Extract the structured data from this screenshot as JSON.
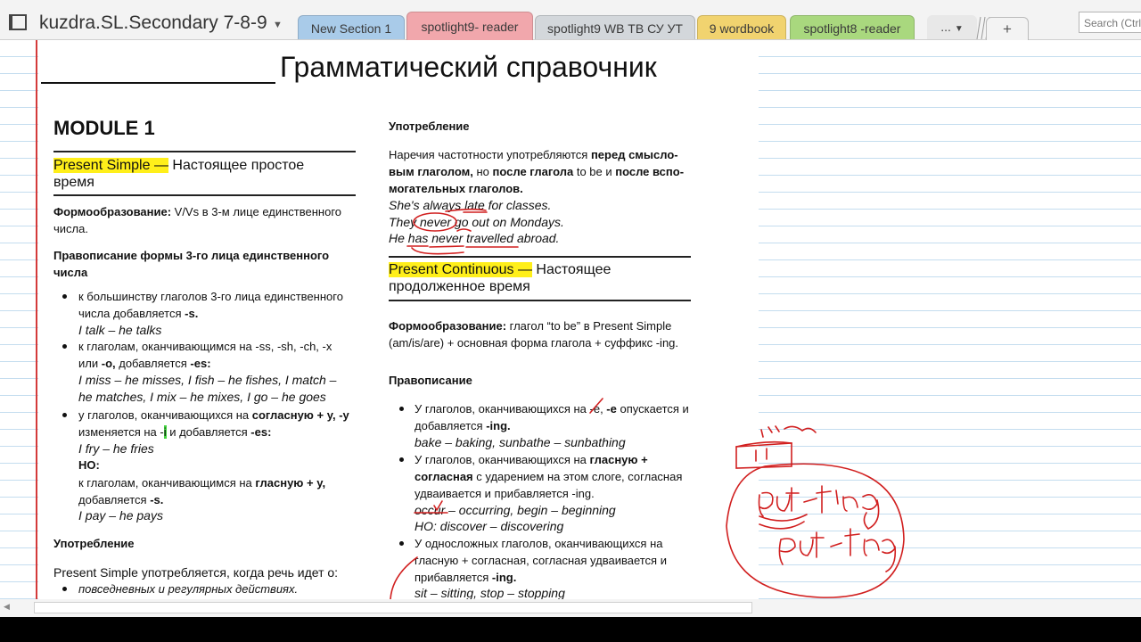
{
  "app": {
    "notebook_title": "kuzdra.SL.Secondary 7-8-9",
    "search_placeholder": "Search (Ctrl"
  },
  "tabs": [
    {
      "label": "New Section 1",
      "color": "#a9cbe9"
    },
    {
      "label": "spotlight9- reader",
      "color": "#f1a7ac",
      "active": true
    },
    {
      "label": "spotlight9 WB ТВ СУ УТ",
      "color": "#d3d7db"
    },
    {
      "label": "9 wordbook",
      "color": "#f1d36f"
    },
    {
      "label": "spotlight8 -reader",
      "color": "#a9d87e"
    }
  ],
  "more_tabs_label": "...",
  "add_tab_label": "+",
  "document": {
    "title": "Грамматический справочник",
    "module": "MODULE 1",
    "left": {
      "ps_heading_hl": "Present Simple —",
      "ps_heading_rest": " Настоящее простое",
      "ps_heading_line2": "время",
      "form_label": "Формообразование:",
      "form_text": " V/Vs в 3-м лице единственного",
      "form_text2": "числа.",
      "spell_heading1": "Правописание формы 3-го лица единственного",
      "spell_heading2": "числа",
      "b1_l1": "к большинству глаголов 3-го лица единственного",
      "b1_l2a": "числа добавляется ",
      "b1_l2b": "-s.",
      "b1_ex": "I talk – he talks",
      "b2_l1": "к глаголам, оканчивающимся на -ss, -sh, -ch, -x",
      "b2_l2a": "или ",
      "b2_l2b": "-o,",
      "b2_l2c": " добавляется ",
      "b2_l2d": "-es:",
      "b2_ex1": "I miss – he misses, I fish – he fishes, I match –",
      "b2_ex2": "he matches, I mix – he mixes, I go – he goes",
      "b3_l1a": "у глаголов, оканчивающихся на ",
      "b3_l1b": "согласную + у, -у",
      "b3_l2a": "изменяется на -",
      "b3_l2b": "i",
      "b3_l2c": " и добавляется ",
      "b3_l2d": "-es:",
      "b3_ex": "I fry – he fries",
      "no_label": "НО:",
      "no_l1a": "к глаголам, оканчивающимся на ",
      "no_l1b": "гласную + у,",
      "no_l2a": "добавляется ",
      "no_l2b": "-s.",
      "no_ex": "I pay – he pays",
      "usage_heading": "Употребление",
      "usage_line": "Present Simple употребляется, когда речь идет о:",
      "usage_b1": "повседневных и регулярных действиях."
    },
    "right": {
      "usage_heading": "Употребление",
      "adv_l1a": "Наречия частотности употребляются ",
      "adv_l1b": "перед смысло-",
      "adv_l2a": "вым глаголом,",
      "adv_l2b": " но ",
      "adv_l2c": "после глагола",
      "adv_l2d": " to be и ",
      "adv_l2e": "после вспо-",
      "adv_l3": "могательных глаголов.",
      "ex1": "She's always late for classes.",
      "ex2": "They never go out on Mondays.",
      "ex3": "He has never travelled abroad.",
      "pc_heading_hl": "Present Continuous —",
      "pc_heading_rest": " Настоящее",
      "pc_heading_line2": "продолженное время",
      "pc_form_label": "Формообразование:",
      "pc_form_text": " глагол “to be” в Present Simple",
      "pc_form_text2": "(am/is/are) + основная форма глагола + суффикс -ing.",
      "spell_heading": "Правописание",
      "s1_l1a": "У глаголов, оканчивающихся на -е, ",
      "s1_l1b": "-е",
      "s1_l1c": " опускается и",
      "s1_l2a": "добавляется ",
      "s1_l2b": "-ing.",
      "s1_ex": "bake – baking, sunbathe – sunbathing",
      "s2_l1a": "У глаголов, оканчивающихся на ",
      "s2_l1b": "гласную +",
      "s2_l2a": "согласная",
      "s2_l2b": " с ударением на этом слоге, согласная",
      "s2_l3": "удваивается и прибавляется -ing.",
      "s2_ex": "occur – occurring, begin – beginning",
      "s2_no": "НО: discover – discovering",
      "s3_l1": "У односложных глаголов, оканчивающихся на",
      "s3_l2": "гласную + согласная, согласная удваивается и",
      "s3_l3a": "прибавляется ",
      "s3_l3b": "-ing.",
      "s3_ex": "sit – sitting, stop – stopping"
    }
  },
  "handwriting": {
    "note1": "put - ting",
    "note2": "put - ting"
  },
  "colors": {
    "highlight_yellow": "#ffef1a",
    "highlight_green": "#43d43f",
    "ink_red": "#d11f1f",
    "margin_red": "#d43a3a",
    "rule_blue": "#c4ddef"
  }
}
